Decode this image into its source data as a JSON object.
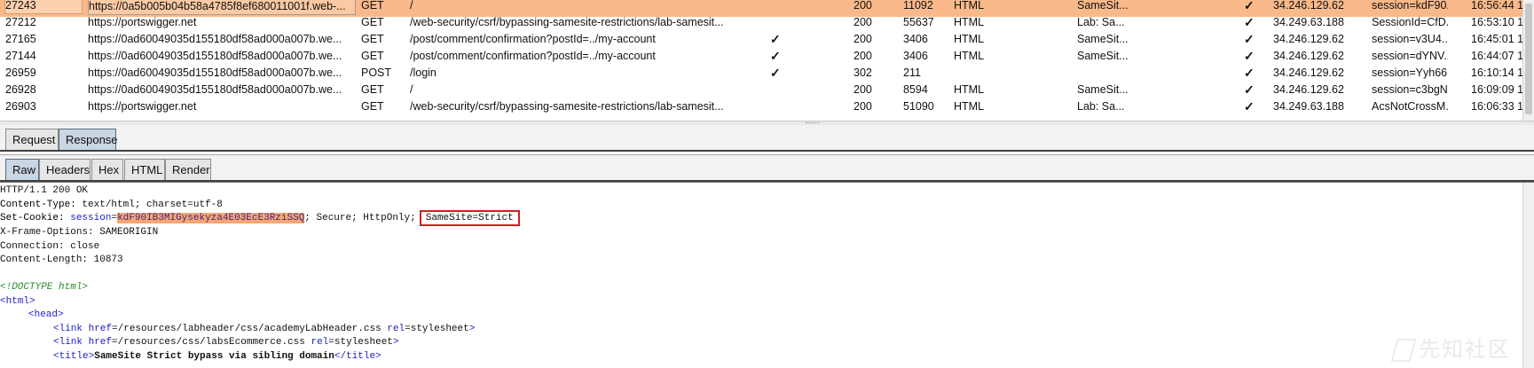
{
  "history": {
    "rows": [
      {
        "id": "27243",
        "host": "https://0a5b005b04b58a4785f8ef680011001f.web-...",
        "method": "GET",
        "url": "/",
        "params": "",
        "status": "200",
        "length": "11092",
        "mime": "HTML",
        "title": "SameSit...",
        "tls": "✓",
        "ip": "34.246.129.62",
        "cookies": "session=kdF90...",
        "time": "16:56:44 1",
        "selected": true
      },
      {
        "id": "27212",
        "host": "https://portswigger.net",
        "method": "GET",
        "url": "/web-security/csrf/bypassing-samesite-restrictions/lab-samesit...",
        "params": "",
        "status": "200",
        "length": "55637",
        "mime": "HTML",
        "title": "Lab: Sa...",
        "tls": "✓",
        "ip": "34.249.63.188",
        "cookies": "SessionId=CfD...",
        "time": "16:53:10 1"
      },
      {
        "id": "27165",
        "host": "https://0ad60049035d155180df58ad000a007b.we...",
        "method": "GET",
        "url": "/post/comment/confirmation?postId=../my-account",
        "params": "✓",
        "status": "200",
        "length": "3406",
        "mime": "HTML",
        "title": "SameSit...",
        "tls": "✓",
        "ip": "34.246.129.62",
        "cookies": "session=v3U4...",
        "time": "16:45:01 1"
      },
      {
        "id": "27144",
        "host": "https://0ad60049035d155180df58ad000a007b.we...",
        "method": "GET",
        "url": "/post/comment/confirmation?postId=../my-account",
        "params": "✓",
        "status": "200",
        "length": "3406",
        "mime": "HTML",
        "title": "SameSit...",
        "tls": "✓",
        "ip": "34.246.129.62",
        "cookies": "session=dYNV...",
        "time": "16:44:07 1"
      },
      {
        "id": "26959",
        "host": "https://0ad60049035d155180df58ad000a007b.we...",
        "method": "POST",
        "url": "/login",
        "params": "✓",
        "status": "302",
        "length": "211",
        "mime": "",
        "title": "",
        "tls": "✓",
        "ip": "34.246.129.62",
        "cookies": "session=Yyh66...",
        "time": "16:10:14 1"
      },
      {
        "id": "26928",
        "host": "https://0ad60049035d155180df58ad000a007b.we...",
        "method": "GET",
        "url": "/",
        "params": "",
        "status": "200",
        "length": "8594",
        "mime": "HTML",
        "title": "SameSit...",
        "tls": "✓",
        "ip": "34.246.129.62",
        "cookies": "session=c3bgN...",
        "time": "16:09:09 1"
      },
      {
        "id": "26903",
        "host": "https://portswigger.net",
        "method": "GET",
        "url": "/web-security/csrf/bypassing-samesite-restrictions/lab-samesit...",
        "params": "",
        "status": "200",
        "length": "51090",
        "mime": "HTML",
        "title": "Lab: Sa...",
        "tls": "✓",
        "ip": "34.249.63.188",
        "cookies": "AcsNotCrossM...",
        "time": "16:06:33 1"
      }
    ]
  },
  "tabs_primary": [
    {
      "label": "Request",
      "active": false
    },
    {
      "label": "Response",
      "active": true
    }
  ],
  "tabs_secondary": [
    {
      "label": "Raw",
      "active": true
    },
    {
      "label": "Headers",
      "active": false
    },
    {
      "label": "Hex",
      "active": false
    },
    {
      "label": "HTML",
      "active": false
    },
    {
      "label": "Render",
      "active": false
    }
  ],
  "response": {
    "status_line": "HTTP/1.1 200 OK",
    "content_type_name": "Content-Type:",
    "content_type_value": " text/html; charset=utf-8",
    "set_cookie_name": "Set-Cookie:",
    "cookie_name": "session",
    "cookie_value": "kdF90IB3MIGysekyza4E03EcE3RziSSQ",
    "cookie_attrs": "; Secure; HttpOnly;",
    "cookie_samesite": "SameSite=Strict",
    "xfo": "X-Frame-Options: SAMEORIGIN",
    "connection": "Connection: close",
    "content_length": "Content-Length: 10873",
    "doctype": "<!DOCTYPE html>",
    "html_open": "<html>",
    "head_open": "<head>",
    "link1_href": "/resources/labheader/css/academyLabHeader.css",
    "link2_href": "/resources/css/labsEcommerce.css",
    "link_rel": "stylesheet",
    "title_text": "SameSite Strict bypass via sibling domain"
  },
  "watermark": "先知社区",
  "colors": {
    "selected_row": "#f9b98a",
    "cookie_highlight": "#f9a672",
    "red_box": "#d21f1f",
    "active_tab": "#c9d6e3"
  }
}
